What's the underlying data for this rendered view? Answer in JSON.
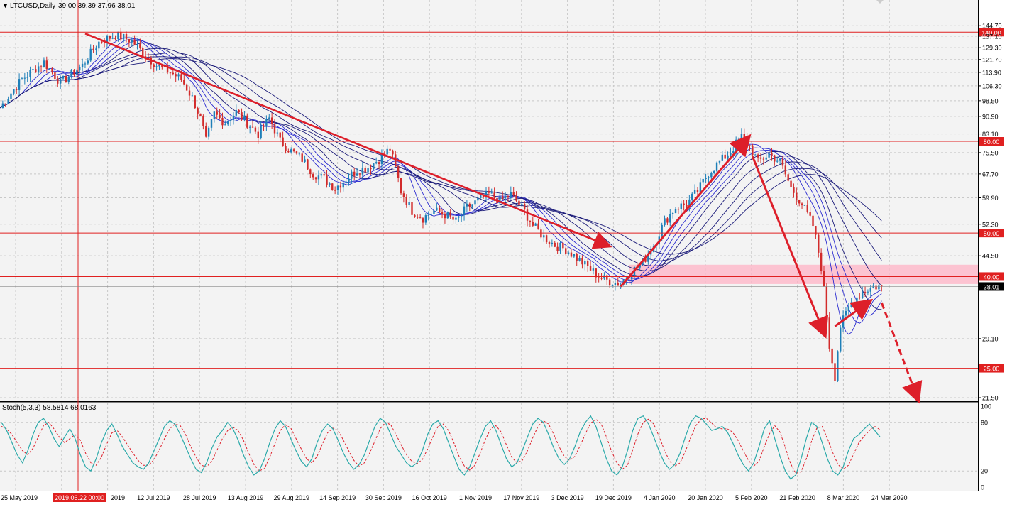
{
  "header": {
    "symbol": "LTCUSD,Daily",
    "ohlc": "39.00 39.39 37.96 38.01",
    "indicator_label": "Stoch(5,3,3) 58.5814 68.0163"
  },
  "colors": {
    "background": "#f3f3f3",
    "grid": "#c8c8c8",
    "bull_candle": "#1e7fb8",
    "bear_candle": "#d22b2b",
    "ma_ribbon": "#1c1c7a",
    "hline": "#e02020",
    "arrow": "#dd1f2a",
    "zone": "#ffb3c6",
    "stoch_main": "#2aa9a9",
    "stoch_signal": "#dd1f2a"
  },
  "chart_data": [
    {
      "type": "candlestick",
      "price_axis_ticks": [
        "144.70",
        "137.10",
        "129.30",
        "121.70",
        "113.90",
        "106.30",
        "98.50",
        "90.90",
        "83.10",
        "75.50",
        "67.70",
        "59.90",
        "52.30",
        "44.50",
        "29.10",
        "21.50"
      ],
      "ylim": [
        21.5,
        148
      ],
      "date_axis_ticks": [
        "25 May 2019",
        "2019.06.22 00:00",
        "2019",
        "12 Jul 2019",
        "28 Jul 2019",
        "13 Aug 2019",
        "29 Aug 2019",
        "14 Sep 2019",
        "30 Sep 2019",
        "16 Oct 2019",
        "1 Nov 2019",
        "17 Nov 2019",
        "3 Dec 2019",
        "19 Dec 2019",
        "4 Jan 2020",
        "20 Jan 2020",
        "5 Feb 2020",
        "21 Feb 2020",
        "8 Mar 2020",
        "24 Mar 2020"
      ],
      "crosshair_date": "2019.06.22 00:00",
      "horizontal_levels": [
        140.0,
        80.0,
        50.0,
        40.0,
        25.0
      ],
      "level_labels": [
        "140.00",
        "80.00",
        "50.00",
        "40.00",
        "25.00"
      ],
      "current_price": 38.01,
      "current_price_label": "38.01",
      "support_zone": [
        38.5,
        42.5
      ],
      "close_path": [
        [
          0,
          95
        ],
        [
          8,
          110
        ],
        [
          16,
          120
        ],
        [
          22,
          108
        ],
        [
          30,
          118
        ],
        [
          36,
          133
        ],
        [
          42,
          138
        ],
        [
          48,
          134
        ],
        [
          52,
          126
        ],
        [
          57,
          118
        ],
        [
          62,
          114
        ],
        [
          66,
          110
        ],
        [
          70,
          100
        ],
        [
          73,
          90
        ],
        [
          75,
          80
        ],
        [
          78,
          92
        ],
        [
          82,
          88
        ],
        [
          86,
          93
        ],
        [
          90,
          88
        ],
        [
          94,
          83
        ],
        [
          98,
          90
        ],
        [
          102,
          80
        ],
        [
          106,
          76
        ],
        [
          110,
          73
        ],
        [
          114,
          68
        ],
        [
          118,
          66
        ],
        [
          122,
          63
        ],
        [
          126,
          66
        ],
        [
          130,
          69
        ],
        [
          134,
          70
        ],
        [
          138,
          73
        ],
        [
          142,
          77
        ],
        [
          146,
          62
        ],
        [
          150,
          56
        ],
        [
          154,
          54
        ],
        [
          158,
          56
        ],
        [
          162,
          55
        ],
        [
          166,
          53
        ],
        [
          170,
          57
        ],
        [
          174,
          59
        ],
        [
          178,
          61
        ],
        [
          182,
          59
        ],
        [
          186,
          61
        ],
        [
          190,
          57
        ],
        [
          194,
          52
        ],
        [
          198,
          49
        ],
        [
          202,
          47
        ],
        [
          206,
          46
        ],
        [
          210,
          44
        ],
        [
          214,
          42
        ],
        [
          218,
          40
        ],
        [
          222,
          39
        ],
        [
          226,
          38.5
        ],
        [
          230,
          41
        ],
        [
          234,
          43
        ],
        [
          238,
          47
        ],
        [
          242,
          53
        ],
        [
          246,
          57
        ],
        [
          250,
          58
        ],
        [
          254,
          62
        ],
        [
          258,
          68
        ],
        [
          262,
          72
        ],
        [
          266,
          76
        ],
        [
          270,
          82
        ],
        [
          273,
          78
        ],
        [
          276,
          72
        ],
        [
          280,
          75
        ],
        [
          284,
          72
        ],
        [
          288,
          63
        ],
        [
          292,
          58
        ],
        [
          296,
          52
        ],
        [
          299,
          42
        ],
        [
          302,
          28
        ],
        [
          304,
          24
        ],
        [
          306,
          31
        ],
        [
          310,
          35
        ],
        [
          314,
          37
        ],
        [
          318,
          38
        ],
        [
          321,
          38.01
        ]
      ],
      "ma_ribbon_periods": [
        2,
        3,
        4,
        5,
        7,
        9,
        11,
        13
      ]
    },
    {
      "type": "line",
      "title": "Stoch(5,3,3)",
      "ylim": [
        0,
        100
      ],
      "axis_ticks": [
        "100",
        "80",
        "20",
        "0"
      ],
      "levels": [
        80,
        20
      ],
      "series": [
        {
          "name": "main",
          "values": [
            80,
            70,
            55,
            40,
            30,
            45,
            65,
            80,
            85,
            75,
            60,
            50,
            62,
            72,
            60,
            40,
            25,
            20,
            35,
            55,
            70,
            78,
            65,
            50,
            40,
            30,
            25,
            22,
            30,
            45,
            60,
            75,
            82,
            78,
            65,
            50,
            35,
            22,
            18,
            30,
            48,
            62,
            70,
            80,
            72,
            58,
            40,
            25,
            15,
            20,
            35,
            55,
            72,
            82,
            75,
            60,
            45,
            32,
            25,
            35,
            55,
            70,
            78,
            72,
            58,
            42,
            30,
            22,
            28,
            40,
            58,
            75,
            85,
            80,
            65,
            50,
            40,
            30,
            25,
            30,
            45,
            65,
            78,
            82,
            72,
            55,
            38,
            22,
            15,
            25,
            42,
            60,
            75,
            82,
            70,
            52,
            35,
            25,
            30,
            45,
            62,
            78,
            85,
            80,
            65,
            48,
            35,
            28,
            35,
            50,
            68,
            80,
            88,
            75,
            55,
            35,
            20,
            15,
            25,
            45,
            70,
            85,
            88,
            78,
            62,
            45,
            30,
            22,
            28,
            42,
            62,
            80,
            88,
            85,
            78,
            70,
            72,
            75,
            68,
            55,
            40,
            28,
            20,
            30,
            50,
            72,
            82,
            60,
            38,
            20,
            10,
            15,
            35,
            60,
            80,
            75,
            55,
            35,
            20,
            15,
            25,
            45,
            60,
            65,
            72,
            78,
            70,
            62
          ]
        },
        {
          "name": "signal",
          "values": [
            75,
            72,
            65,
            55,
            45,
            40,
            48,
            62,
            76,
            80,
            72,
            62,
            55,
            60,
            65,
            58,
            42,
            30,
            27,
            37,
            53,
            67,
            70,
            62,
            52,
            42,
            33,
            27,
            27,
            34,
            46,
            60,
            72,
            78,
            76,
            65,
            50,
            37,
            27,
            25,
            32,
            46,
            60,
            70,
            74,
            70,
            58,
            42,
            28,
            20,
            23,
            37,
            54,
            70,
            77,
            73,
            60,
            47,
            35,
            30,
            38,
            53,
            67,
            73,
            70,
            58,
            45,
            33,
            26,
            30,
            42,
            57,
            72,
            80,
            77,
            65,
            52,
            40,
            32,
            29,
            34,
            47,
            62,
            75,
            78,
            70,
            55,
            38,
            26,
            21,
            27,
            42,
            59,
            72,
            76,
            68,
            52,
            37,
            30,
            33,
            45,
            61,
            75,
            82,
            78,
            65,
            50,
            38,
            33,
            38,
            51,
            66,
            79,
            84,
            78,
            62,
            44,
            30,
            22,
            27,
            46,
            66,
            80,
            84,
            78,
            63,
            46,
            32,
            26,
            30,
            44,
            61,
            76,
            84,
            85,
            79,
            73,
            72,
            72,
            68,
            58,
            45,
            33,
            26,
            32,
            50,
            66,
            76,
            68,
            49,
            29,
            17,
            19,
            35,
            57,
            73,
            75,
            60,
            43,
            28,
            22,
            27,
            41,
            55,
            63,
            70,
            75,
            71
          ]
        }
      ]
    }
  ],
  "annotations": {
    "arrows": 7,
    "trend_lines": 1
  }
}
